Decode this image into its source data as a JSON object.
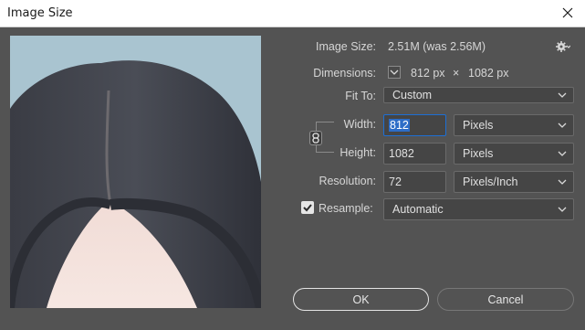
{
  "window": {
    "title": "Image Size"
  },
  "info": {
    "image_size_label": "Image Size:",
    "image_size_value": "2.51M (was 2.56M)",
    "dimensions_label": "Dimensions:",
    "dimensions_width": "812 px",
    "dimensions_sep": "×",
    "dimensions_height": "1082 px"
  },
  "fit_to": {
    "label": "Fit To:",
    "value": "Custom"
  },
  "width": {
    "label": "Width:",
    "value": "812",
    "unit": "Pixels"
  },
  "height": {
    "label": "Height:",
    "value": "1082",
    "unit": "Pixels"
  },
  "resolution": {
    "label": "Resolution:",
    "value": "72",
    "unit": "Pixels/Inch"
  },
  "resample": {
    "label": "Resample:",
    "checked": true,
    "value": "Automatic"
  },
  "buttons": {
    "ok": "OK",
    "cancel": "Cancel"
  },
  "icons": {
    "close": "close-icon",
    "gear": "gear-icon",
    "chevron": "chevron-down-icon",
    "link": "link-icon",
    "check": "check-icon"
  },
  "colors": {
    "dialog_bg": "#535353",
    "field_bg": "#454545",
    "focus_border": "#1d6fd4",
    "selection": "#2d6dc7"
  }
}
